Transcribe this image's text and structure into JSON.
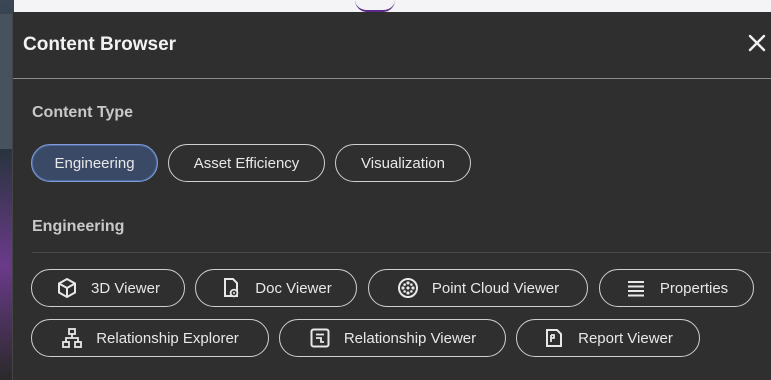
{
  "panel": {
    "title": "Content Browser",
    "close_icon": "close-icon"
  },
  "content_type": {
    "heading": "Content Type",
    "chips": [
      {
        "label": "Engineering",
        "selected": true
      },
      {
        "label": "Asset Efficiency",
        "selected": false
      },
      {
        "label": "Visualization",
        "selected": false
      }
    ]
  },
  "engineering": {
    "heading": "Engineering",
    "tools": [
      {
        "label": "3D Viewer",
        "icon": "cube-icon"
      },
      {
        "label": "Doc Viewer",
        "icon": "document-eye-icon"
      },
      {
        "label": "Point Cloud Viewer",
        "icon": "point-cloud-icon"
      },
      {
        "label": "Properties",
        "icon": "list-lines-icon"
      },
      {
        "label": "Relationship Explorer",
        "icon": "hierarchy-icon"
      },
      {
        "label": "Relationship Viewer",
        "icon": "linked-boxes-icon"
      },
      {
        "label": "Report Viewer",
        "icon": "report-icon"
      }
    ]
  },
  "colors": {
    "panel_bg": "#2f2f2f",
    "selected_chip": "#3a4a66",
    "selected_border": "#7f9cd6"
  }
}
